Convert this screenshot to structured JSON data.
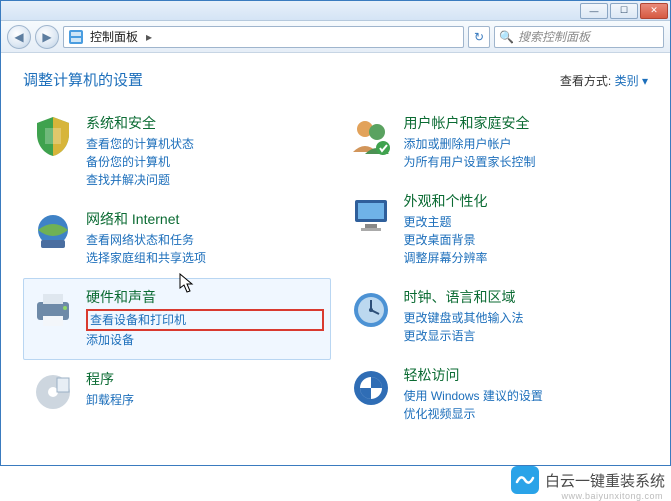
{
  "window": {
    "min_tip": "最小化",
    "max_tip": "最大化",
    "close_tip": "关闭"
  },
  "nav": {
    "back_tip": "后退",
    "fwd_tip": "前进",
    "breadcrumb": "控制面板",
    "sep": "▸",
    "refresh_tip": "刷新",
    "search_placeholder": "搜索控制面板"
  },
  "header": {
    "title": "调整计算机的设置",
    "viewby_label": "查看方式:",
    "viewby_value": "类别",
    "viewby_caret": "▾"
  },
  "left": [
    {
      "id": "system-security",
      "title": "系统和安全",
      "links": [
        "查看您的计算机状态",
        "备份您的计算机",
        "查找并解决问题"
      ]
    },
    {
      "id": "network",
      "title": "网络和 Internet",
      "links": [
        "查看网络状态和任务",
        "选择家庭组和共享选项"
      ]
    },
    {
      "id": "hardware-sound",
      "title": "硬件和声音",
      "links": [
        "查看设备和打印机",
        "添加设备"
      ]
    },
    {
      "id": "programs",
      "title": "程序",
      "links": [
        "卸载程序"
      ]
    }
  ],
  "right": [
    {
      "id": "user-accounts",
      "title": "用户帐户和家庭安全",
      "links": [
        "添加或删除用户帐户",
        "为所有用户设置家长控制"
      ]
    },
    {
      "id": "appearance",
      "title": "外观和个性化",
      "links": [
        "更改主题",
        "更改桌面背景",
        "调整屏幕分辨率"
      ]
    },
    {
      "id": "clock-region",
      "title": "时钟、语言和区域",
      "links": [
        "更改键盘或其他输入法",
        "更改显示语言"
      ]
    },
    {
      "id": "ease-of-access",
      "title": "轻松访问",
      "links": [
        "使用 Windows 建议的设置",
        "优化视频显示"
      ]
    }
  ],
  "highlight": {
    "category_id": "hardware-sound",
    "link_index": 0
  },
  "watermark": {
    "text": "白云一键重装系统",
    "url": "www.baiyunxitong.com"
  }
}
